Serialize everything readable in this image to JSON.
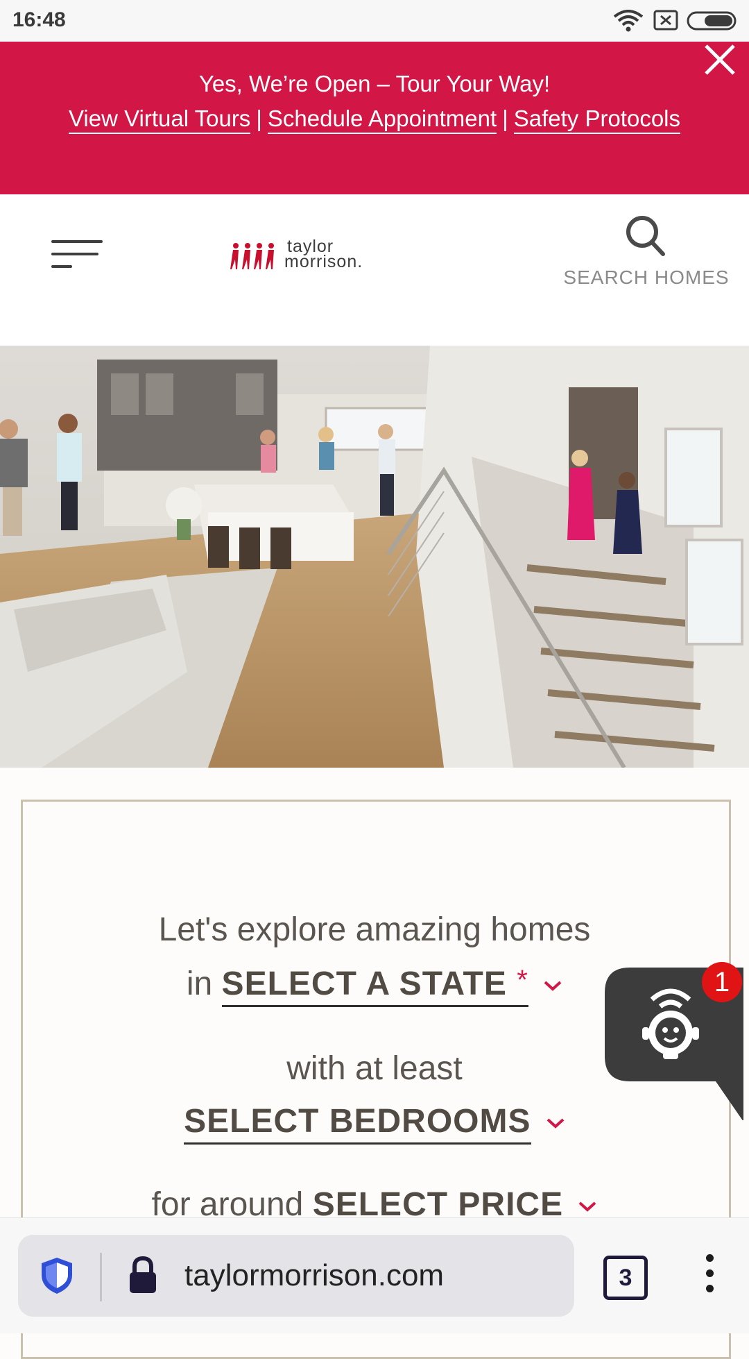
{
  "status_bar": {
    "time": "16:48"
  },
  "promo_banner": {
    "headline": "Yes, We’re Open – Tour Your Way!",
    "links": [
      "View Virtual Tours",
      "Schedule Appointment",
      "Safety Protocols"
    ],
    "separator": "|"
  },
  "header": {
    "logo_line1": "taylor",
    "logo_line2": "morrison.",
    "search_label": "SEARCH HOMES"
  },
  "search_form": {
    "line1": "Let's explore amazing homes",
    "state_prefix": "in",
    "state_value": "SELECT A STATE",
    "required_mark": "*",
    "bedrooms_prefix": "with at least",
    "bedrooms_value": "SELECT BEDROOMS",
    "price_prefix": "for around",
    "price_value": "SELECT PRICE"
  },
  "chat_widget": {
    "badge_count": "1"
  },
  "browser_bar": {
    "url": "taylormorrison.com",
    "tab_count": "3"
  },
  "colors": {
    "brand_red": "#d21646",
    "text_brown": "#5a554f",
    "card_border": "#cbbfae"
  }
}
